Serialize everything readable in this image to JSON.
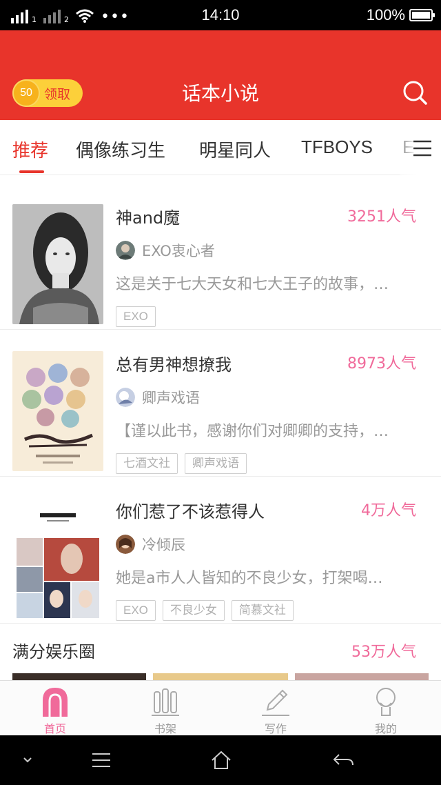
{
  "status_bar": {
    "carrier1": "1",
    "carrier2": "2",
    "more_dots": "•••",
    "time": "14:10",
    "battery": "100%"
  },
  "header": {
    "coin_value": "50",
    "claim_label": "领取",
    "title": "话本小说"
  },
  "tabs": [
    "推荐",
    "偶像练习生",
    "明星同人",
    "TFBOYS",
    "E"
  ],
  "books": [
    {
      "title": "神and魔",
      "popularity": "3251人气",
      "author": "EXO衷心者",
      "description": "这是关于七大天女和七大王子的故事，…",
      "tags": [
        "EXO"
      ]
    },
    {
      "title": "总有男神想撩我",
      "popularity": "8973人气",
      "author": "卿声戏语",
      "description": "【谨以此书，感谢你们对卿卿的支持，…",
      "tags": [
        "七酒文社",
        "卿声戏语"
      ]
    },
    {
      "title": "你们惹了不该惹得人",
      "popularity": "4万人气",
      "author": "冷倾辰",
      "description": "她是a市人人皆知的不良少女，打架喝…",
      "tags": [
        "EXO",
        "不良少女",
        "简慕文社"
      ]
    }
  ],
  "section": {
    "title": "满分娱乐圈",
    "popularity": "53万人气"
  },
  "bottom_nav": [
    "首页",
    "书架",
    "写作",
    "我的"
  ],
  "colors": {
    "brand_red": "#e8342b",
    "accent_pink": "#f06a9a",
    "coin_yellow": "#fcd03a"
  }
}
